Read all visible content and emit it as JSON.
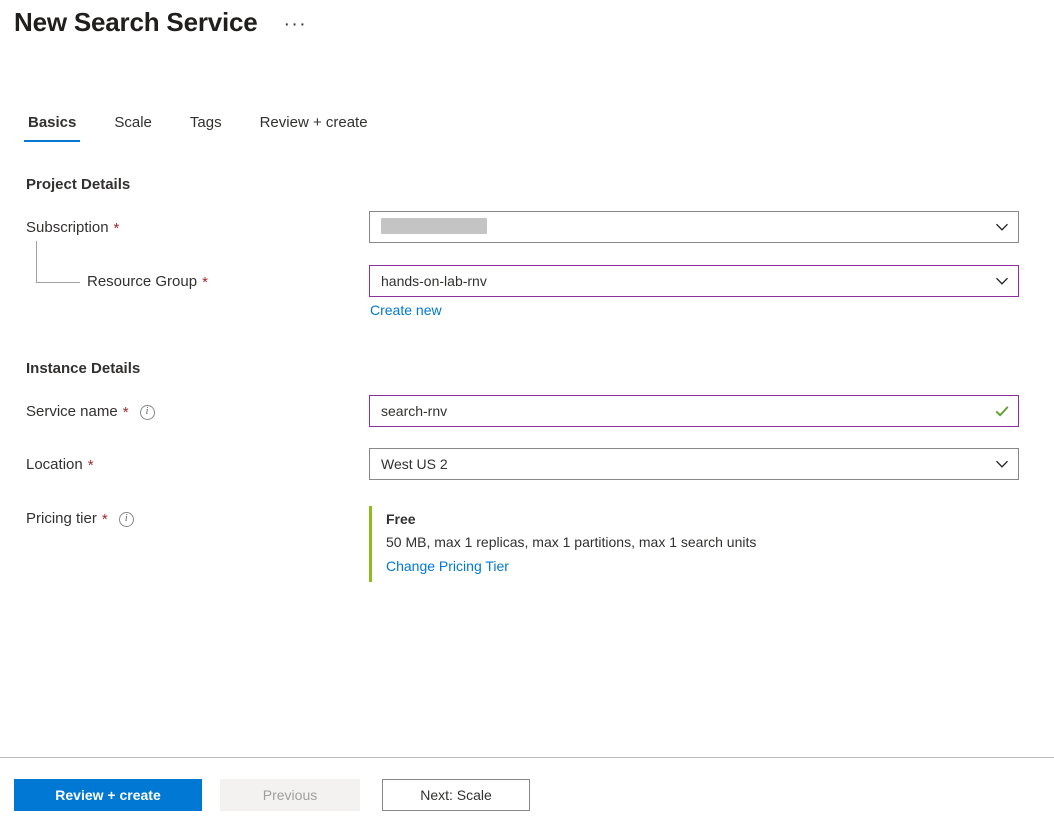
{
  "header": {
    "title": "New Search Service",
    "more_menu": "···"
  },
  "tabs": [
    {
      "label": "Basics",
      "active": true
    },
    {
      "label": "Scale",
      "active": false
    },
    {
      "label": "Tags",
      "active": false
    },
    {
      "label": "Review + create",
      "active": false
    }
  ],
  "sections": {
    "project_details": {
      "title": "Project Details",
      "subscription": {
        "label": "Subscription",
        "required": "*",
        "value": "",
        "redacted": true
      },
      "resource_group": {
        "label": "Resource Group",
        "required": "*",
        "value": "hands-on-lab-rnv",
        "create_new_link": "Create new"
      }
    },
    "instance_details": {
      "title": "Instance Details",
      "service_name": {
        "label": "Service name",
        "required": "*",
        "value": "search-rnv",
        "valid": true
      },
      "location": {
        "label": "Location",
        "required": "*",
        "value": "West US 2"
      },
      "pricing_tier": {
        "label": "Pricing tier",
        "required": "*",
        "tier_name": "Free",
        "tier_description": "50 MB, max 1 replicas, max 1 partitions, max 1 search units",
        "change_link": "Change Pricing Tier"
      }
    }
  },
  "footer": {
    "review_create": "Review + create",
    "previous": "Previous",
    "next": "Next: Scale"
  },
  "colors": {
    "accent_blue": "#0078d4",
    "link_blue": "#0078d4",
    "required_red": "#a4262c",
    "focus_purple": "#8e2f9e",
    "valid_green": "#5a9e21",
    "tier_bar_green": "#8cbd18",
    "redaction_gray": "#c4c4c4"
  }
}
